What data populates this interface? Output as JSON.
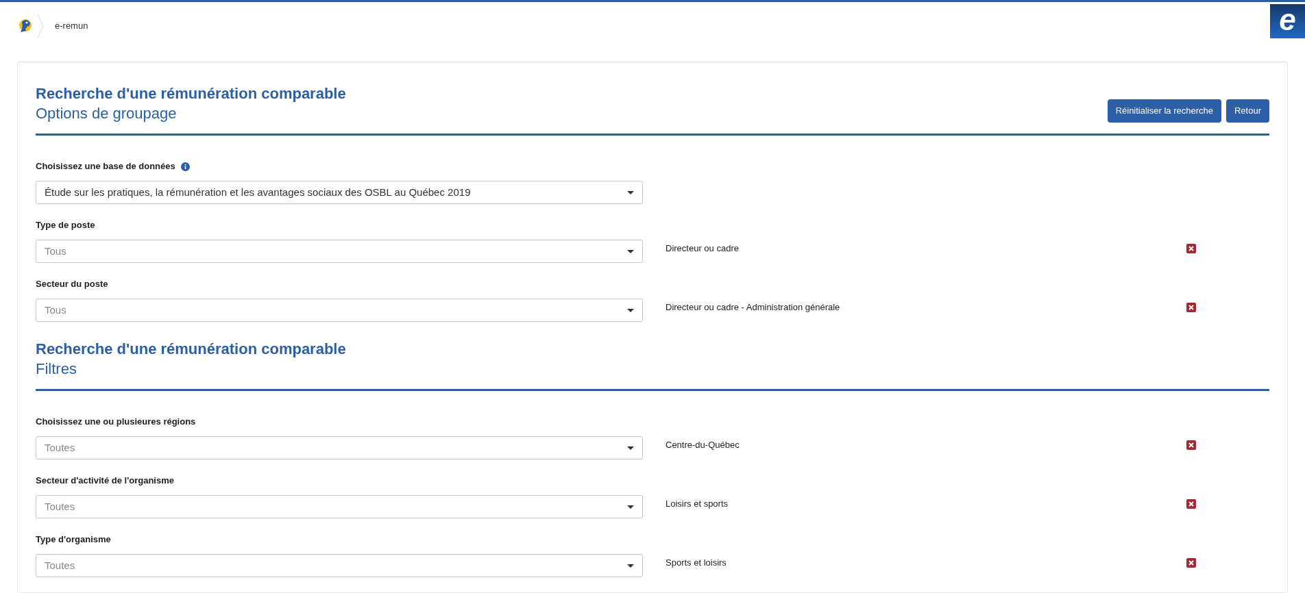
{
  "header": {
    "logo_letter": "e",
    "breadcrumb": "e-remun"
  },
  "sections": [
    {
      "title": "Recherche d'une rémunération comparable",
      "subtitle": "Options de groupage",
      "buttons": [
        "Réinitialiser la recherche",
        "Retour"
      ],
      "fields": [
        {
          "label": "Choisissez une base de données",
          "info": true,
          "value": "Étude sur les pratiques, la rémunération et les avantages sociaux des OSBL au Québec 2019"
        },
        {
          "label": "Type de poste",
          "placeholder": "Tous",
          "chosen": "Directeur ou cadre"
        },
        {
          "label": "Secteur du poste",
          "placeholder": "Tous",
          "chosen": "Directeur ou cadre - Administration générale"
        }
      ]
    },
    {
      "title": "Recherche d'une rémunération comparable",
      "subtitle": "Filtres",
      "fields": [
        {
          "label": "Choisissez une ou plusieures régions",
          "placeholder": "Toutes",
          "chosen": "Centre-du-Québec"
        },
        {
          "label": "Secteur d'activité de l'organisme",
          "placeholder": "Toutes",
          "chosen": "Loisirs et sports"
        },
        {
          "label": "Type d'organisme",
          "placeholder": "Toutes",
          "chosen": "Sports et loisirs"
        }
      ]
    }
  ]
}
